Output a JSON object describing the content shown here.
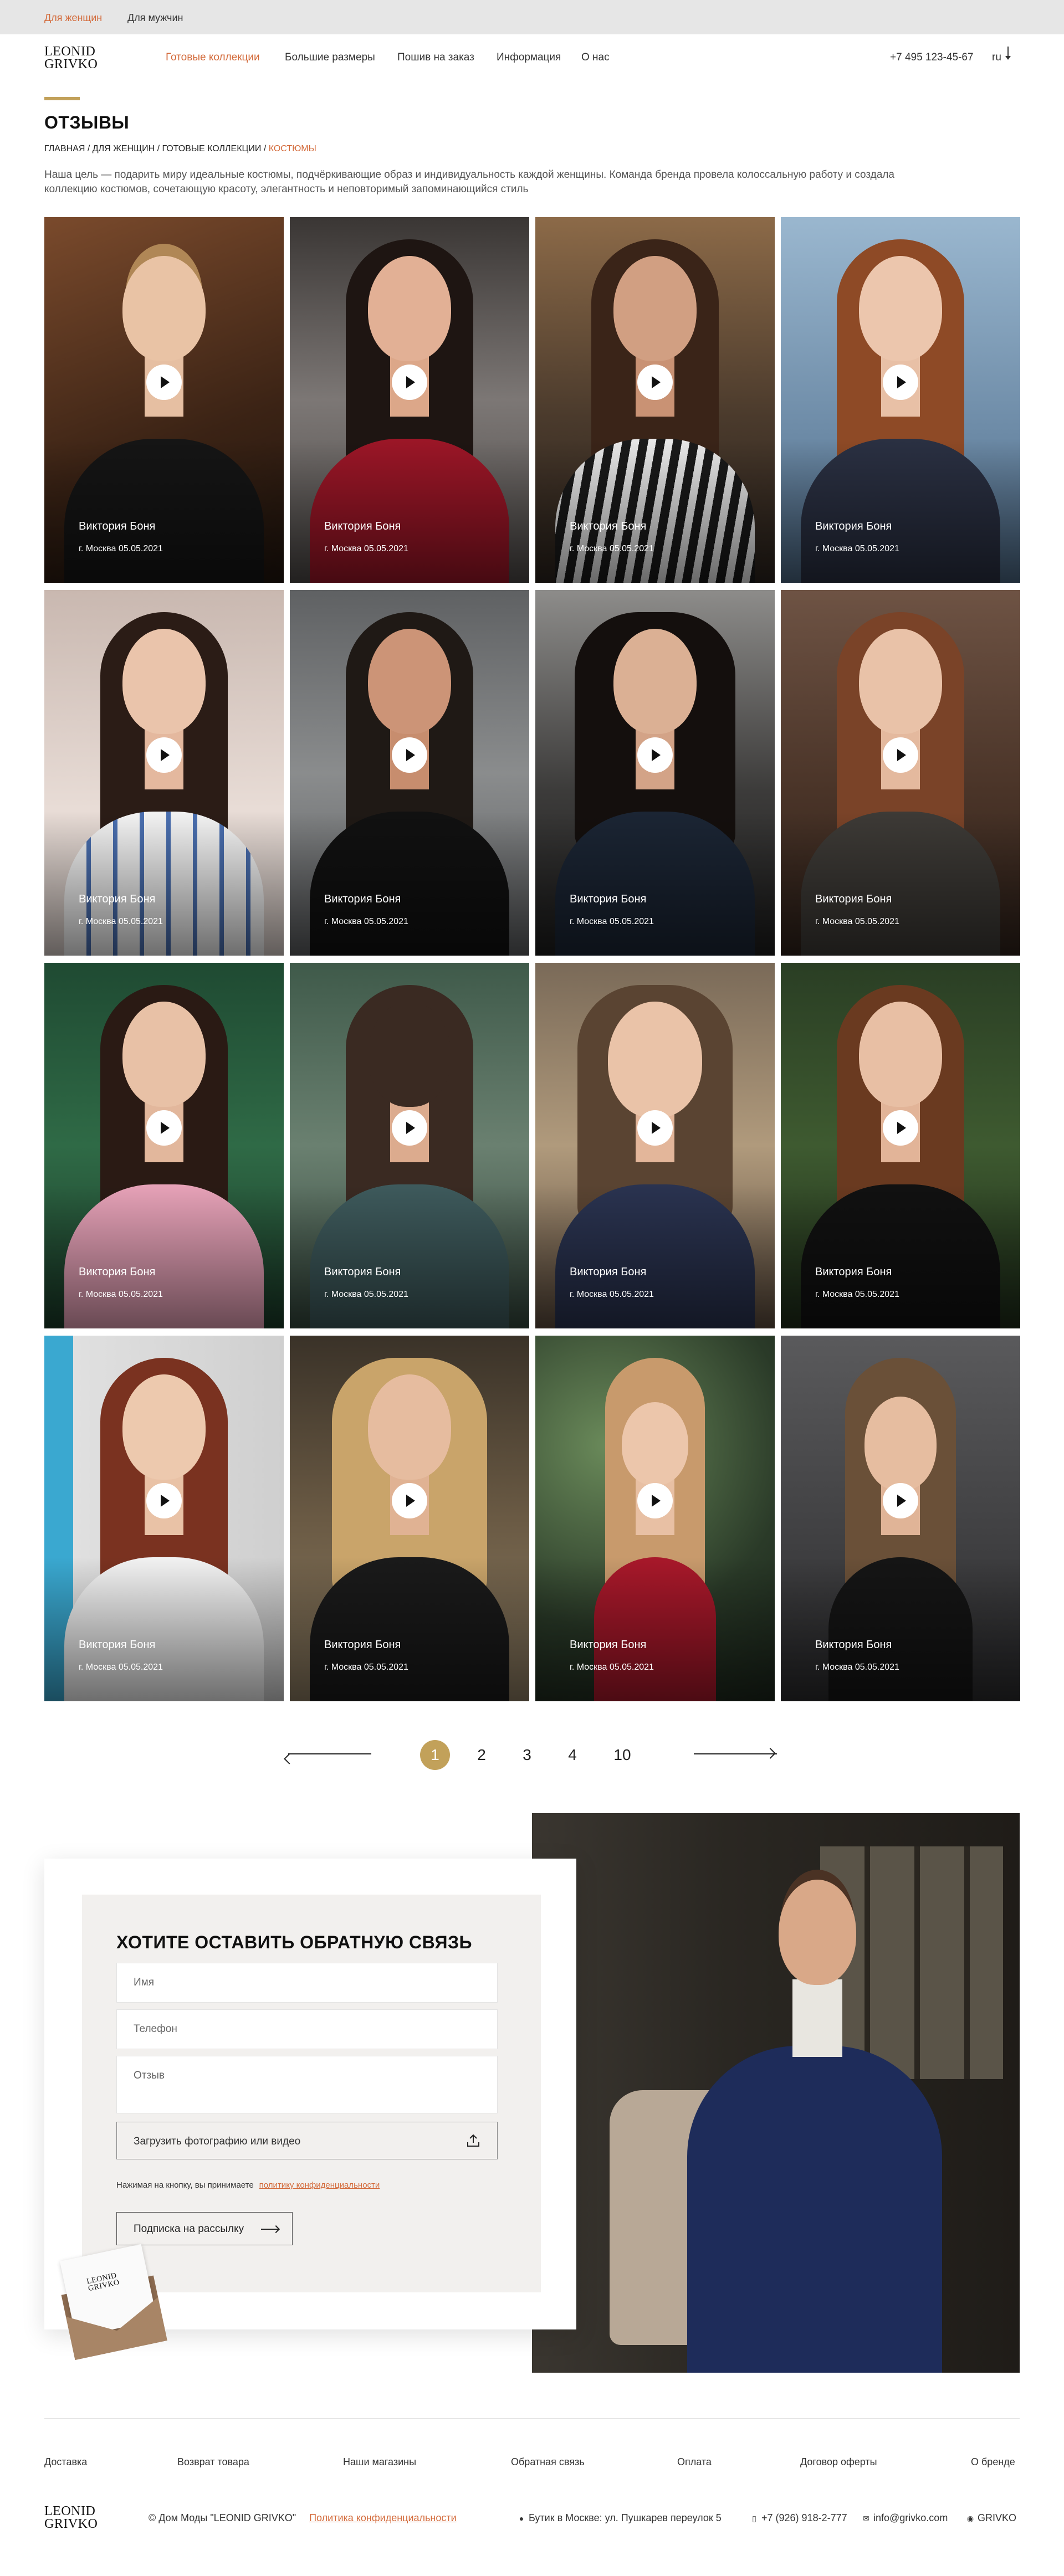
{
  "topbar": {
    "women": "Для женщин",
    "men": "Для мужчин"
  },
  "header": {
    "logo_line1": "LEONID",
    "logo_line2": "GRIVKO",
    "nav": [
      "Готовые коллекции",
      "Большие размеры",
      "Пошив на заказ",
      "Информация",
      "О нас"
    ],
    "phone": "+7 495 123-45-67",
    "lang": "ru"
  },
  "page": {
    "title": "ОТЗЫВЫ",
    "breadcrumb": [
      "ГЛАВНАЯ",
      "ДЛЯ ЖЕНЩИН",
      "ГОТОВЫЕ КОЛЛЕКЦИИ",
      "КОСТЮМЫ"
    ],
    "breadcrumb_sep": " / ",
    "intro": "Наша цель — подарить миру идеальные костюмы, подчёркивающие образ и индивидуальность каждой женщины. Команда бренда провела колоссальную работу и создала коллекцию костюмов, сочетающую красоту, элегантность и неповторимый запоминающийся стиль"
  },
  "reviews": [
    {
      "name": "Виктория Боня",
      "meta": "г. Москва 05.05.2021"
    },
    {
      "name": "Виктория Боня",
      "meta": "г. Москва 05.05.2021"
    },
    {
      "name": "Виктория Боня",
      "meta": "г. Москва 05.05.2021"
    },
    {
      "name": "Виктория Боня",
      "meta": "г. Москва 05.05.2021"
    },
    {
      "name": "Виктория Боня",
      "meta": "г. Москва 05.05.2021"
    },
    {
      "name": "Виктория Боня",
      "meta": "г. Москва 05.05.2021"
    },
    {
      "name": "Виктория Боня",
      "meta": "г. Москва 05.05.2021"
    },
    {
      "name": "Виктория Боня",
      "meta": "г. Москва 05.05.2021"
    },
    {
      "name": "Виктория Боня",
      "meta": "г. Москва 05.05.2021"
    },
    {
      "name": "Виктория Боня",
      "meta": "г. Москва 05.05.2021"
    },
    {
      "name": "Виктория Боня",
      "meta": "г. Москва 05.05.2021"
    },
    {
      "name": "Виктория Боня",
      "meta": "г. Москва 05.05.2021"
    },
    {
      "name": "Виктория Боня",
      "meta": "г. Москва 05.05.2021"
    },
    {
      "name": "Виктория Боня",
      "meta": "г. Москва 05.05.2021"
    },
    {
      "name": "Виктория Боня",
      "meta": "г. Москва 05.05.2021"
    },
    {
      "name": "Виктория Боня",
      "meta": "г. Москва 05.05.2021"
    }
  ],
  "pagination": {
    "pages": [
      "1",
      "2",
      "3",
      "4",
      "10"
    ],
    "current": "1"
  },
  "feedback": {
    "title": "ХОТИТЕ ОСТАВИТЬ ОБРАТНУЮ СВЯЗЬ",
    "name_placeholder": "Имя",
    "phone_placeholder": "Телефон",
    "review_placeholder": "Отзыв",
    "upload_label": "Загрузить фотографию или видео",
    "consent_text": "Нажимая на кнопку, вы принимаете",
    "consent_link": "политику конфиденциальности",
    "subscribe_label": "Подписка на рассылку"
  },
  "footer": {
    "nav": [
      "Доставка",
      "Возврат товара",
      "Наши магазины",
      "Обратная связь",
      "Оплата",
      "Договор оферты",
      "О бренде"
    ],
    "copyright": "© Дом Моды \"LEONID GRIVKO\"",
    "policy": "Политика конфиденциальности",
    "address": "Бутик в Москве: ул. Пушкарев переулок 5",
    "phone": "+7 (926) 918-2-777",
    "email": "info@grivko.com",
    "brand": "GRIVKO"
  },
  "colors": {
    "accent": "#d36a3a",
    "gold": "#c2a15a"
  }
}
